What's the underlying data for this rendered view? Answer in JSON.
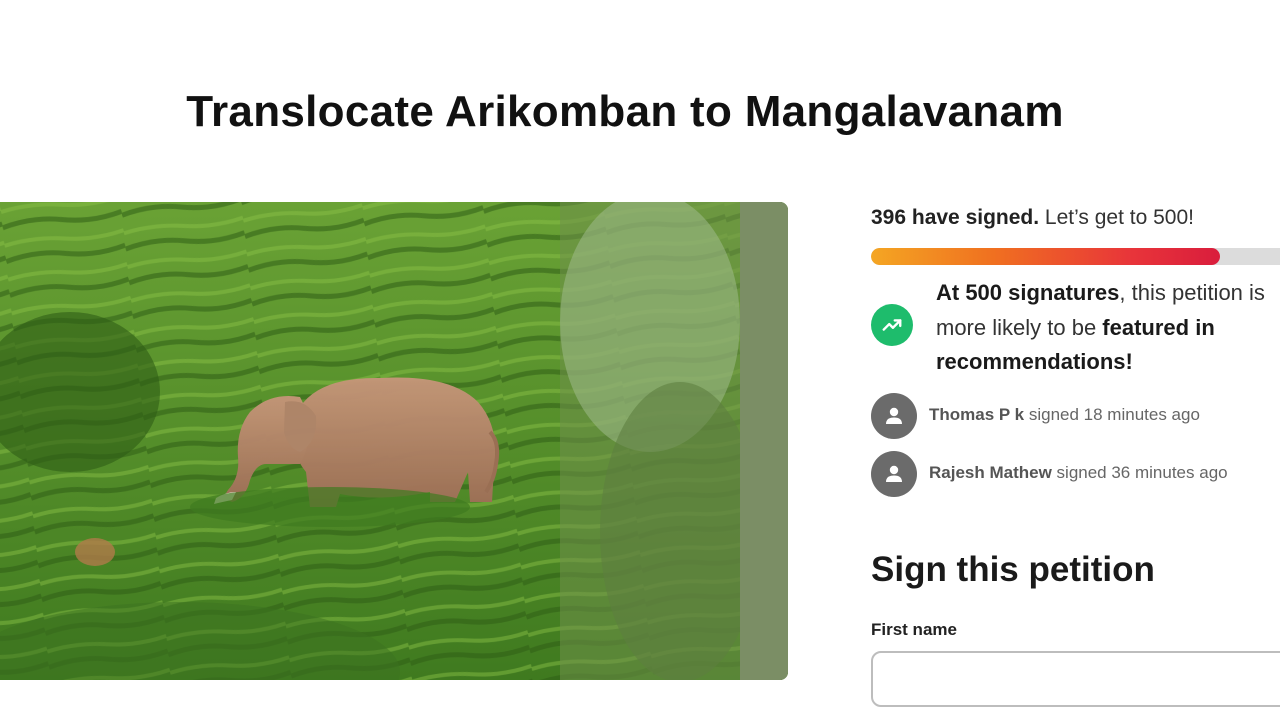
{
  "petition": {
    "title": "Translocate Arikomban to Mangalavanam"
  },
  "progress": {
    "signed_count_text": "396 have signed.",
    "goal_text": " Let’s get to 500!",
    "signed": 396,
    "goal": 500,
    "fill_fraction": 0.83
  },
  "milestone": {
    "icon": "trending-up-icon",
    "part1": "At 500 signatures",
    "part2": ", this petition is more likely to be ",
    "part3": "featured in recommendations!"
  },
  "recent_signers": [
    {
      "name": "Thomas P k",
      "action": " signed 18 minutes ago"
    },
    {
      "name": "Rajesh Mathew",
      "action": " signed 36 minutes ago"
    }
  ],
  "sign_form": {
    "heading": "Sign this petition",
    "first_name_label": "First name",
    "first_name_value": ""
  },
  "colors": {
    "milestone_icon_bg": "#1ebc6c",
    "progress_start": "#f4a623",
    "progress_end": "#d91d3c",
    "avatar_bg": "#6b6b6b"
  }
}
